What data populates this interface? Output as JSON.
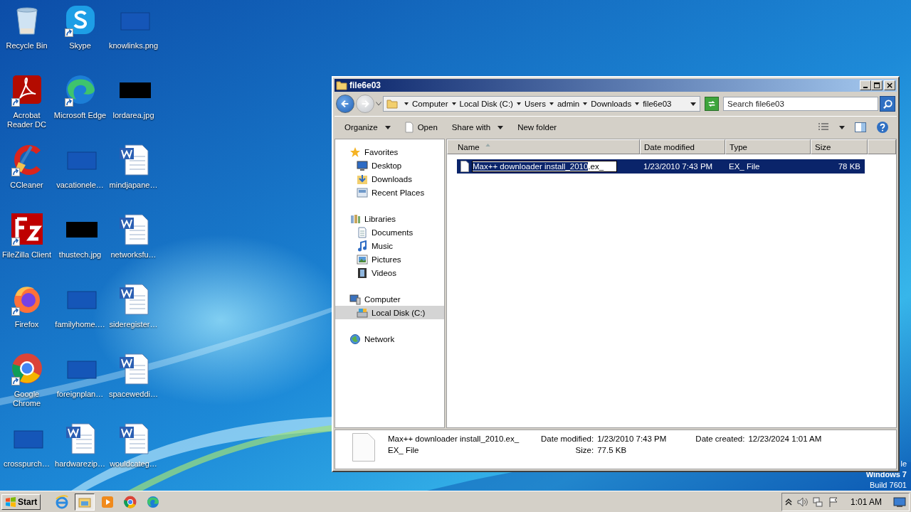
{
  "desktop": {
    "icons": [
      {
        "label": "Recycle Bin",
        "kind": "recycle",
        "shortcut": false
      },
      {
        "label": "Acrobat Reader DC",
        "kind": "pdf",
        "shortcut": true
      },
      {
        "label": "CCleaner",
        "kind": "ccleaner",
        "shortcut": true
      },
      {
        "label": "FileZilla Client",
        "kind": "filezilla",
        "shortcut": true
      },
      {
        "label": "Firefox",
        "kind": "firefox",
        "shortcut": true
      },
      {
        "label": "Google Chrome",
        "kind": "chrome",
        "shortcut": true
      },
      {
        "label": "crosspurch…",
        "kind": "blank",
        "shortcut": false
      },
      {
        "label": "Skype",
        "kind": "skype",
        "shortcut": true
      },
      {
        "label": "Microsoft Edge",
        "kind": "edge",
        "shortcut": true
      },
      {
        "label": "vacationele…",
        "kind": "blank",
        "shortcut": false
      },
      {
        "label": "thustech.jpg",
        "kind": "black",
        "shortcut": false
      },
      {
        "label": "familyhome.…",
        "kind": "blank",
        "shortcut": false
      },
      {
        "label": "foreignplan…",
        "kind": "blank",
        "shortcut": false
      },
      {
        "label": "hardwarezip…",
        "kind": "word",
        "shortcut": false
      },
      {
        "label": "knowlinks.png",
        "kind": "blank",
        "shortcut": false
      },
      {
        "label": "lordarea.jpg",
        "kind": "black",
        "shortcut": false
      },
      {
        "label": "mindjapane…",
        "kind": "word",
        "shortcut": false
      },
      {
        "label": "networksfu…",
        "kind": "word",
        "shortcut": false
      },
      {
        "label": "sideregister…",
        "kind": "word",
        "shortcut": false
      },
      {
        "label": "spaceweddi…",
        "kind": "word",
        "shortcut": false
      },
      {
        "label": "wouldcateg…",
        "kind": "word",
        "shortcut": false
      }
    ],
    "badge": [
      "le",
      "Windows 7",
      "Build 7601"
    ]
  },
  "explorer": {
    "title": "file6e03",
    "address": [
      "Computer",
      "Local Disk (C:)",
      "Users",
      "admin",
      "Downloads",
      "file6e03"
    ],
    "search_placeholder": "Search file6e03",
    "toolbar": [
      {
        "label": "Organize",
        "kind": "menu"
      },
      {
        "label": "Open",
        "kind": "open"
      },
      {
        "label": "Share with",
        "kind": "menu"
      },
      {
        "label": "New folder",
        "kind": "plain"
      }
    ],
    "nav": [
      {
        "label": "Favorites",
        "kind": "star",
        "selected": false,
        "children": [
          {
            "label": "Desktop",
            "kind": "desktop",
            "selected": false
          },
          {
            "label": "Downloads",
            "kind": "downloads",
            "selected": false
          },
          {
            "label": "Recent Places",
            "kind": "recent",
            "selected": false
          }
        ]
      },
      {
        "label": "Libraries",
        "kind": "libraries",
        "selected": false,
        "children": [
          {
            "label": "Documents",
            "kind": "documents",
            "selected": false
          },
          {
            "label": "Music",
            "kind": "music",
            "selected": false
          },
          {
            "label": "Pictures",
            "kind": "pictures",
            "selected": false
          },
          {
            "label": "Videos",
            "kind": "videos",
            "selected": false
          }
        ]
      },
      {
        "label": "Computer",
        "kind": "computer",
        "selected": false,
        "children": [
          {
            "label": "Local Disk (C:)",
            "kind": "disk",
            "selected": true
          }
        ]
      },
      {
        "label": "Network",
        "kind": "network",
        "selected": false
      }
    ],
    "columns": [
      {
        "label": "Name",
        "sorted": true
      },
      {
        "label": "Date modified",
        "sorted": false
      },
      {
        "label": "Type",
        "sorted": false
      },
      {
        "label": "Size",
        "sorted": false
      }
    ],
    "files": [
      {
        "selected": true,
        "renaming": true,
        "name_selected": "Max++ downloader install_2010",
        "name_rest": ".ex_",
        "date": "1/23/2010 7:43 PM",
        "type": "EX_ File",
        "size": "78 KB"
      }
    ],
    "details": {
      "name": "Max++ downloader install_2010.ex_",
      "type": "EX_ File",
      "modified_label": "Date modified:",
      "modified": "1/23/2010 7:43 PM",
      "size_label": "Size:",
      "size": "77.5 KB",
      "created_label": "Date created:",
      "created": "12/23/2024 1:01 AM"
    }
  },
  "taskbar": {
    "start": "Start",
    "pinned": [
      {
        "kind": "ie",
        "selected": false
      },
      {
        "kind": "explorer",
        "selected": true
      },
      {
        "kind": "media",
        "selected": false
      },
      {
        "kind": "chrome",
        "selected": false
      },
      {
        "kind": "edge",
        "selected": false
      }
    ],
    "time": "1:01 AM"
  }
}
